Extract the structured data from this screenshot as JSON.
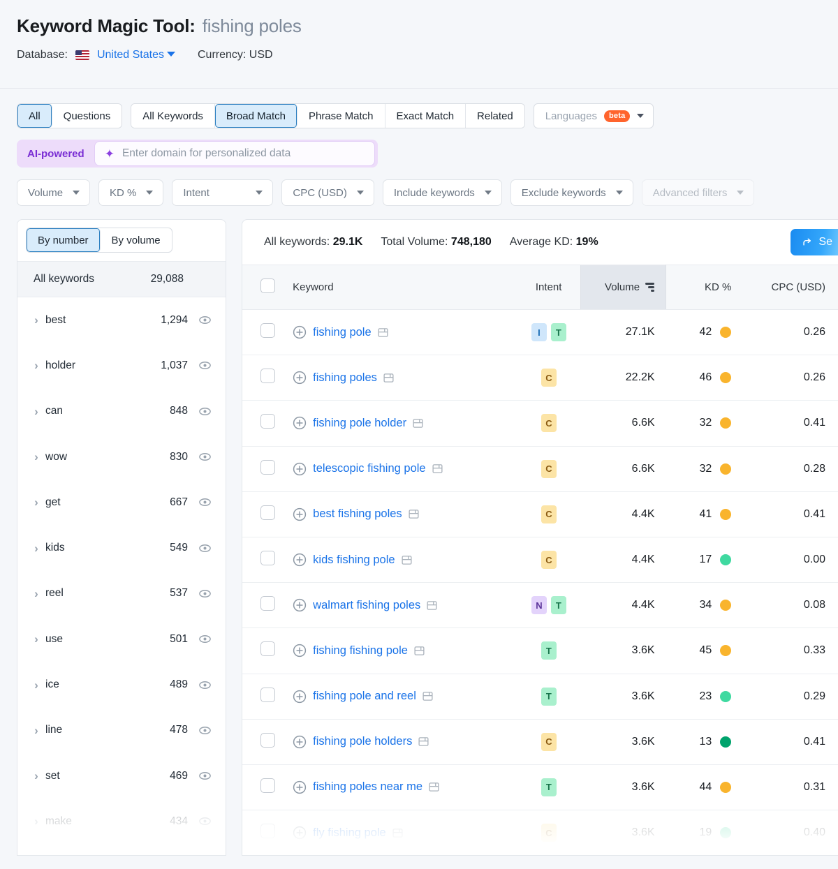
{
  "header": {
    "title_prefix": "Keyword Magic Tool:",
    "query": "fishing poles",
    "database_label": "Database:",
    "database_value": "United States",
    "currency": "Currency: USD",
    "flag_icon": "us-flag-icon"
  },
  "tabs": {
    "scope": [
      {
        "label": "All",
        "active": true
      },
      {
        "label": "Questions",
        "active": false
      }
    ],
    "match": [
      {
        "label": "All Keywords",
        "active": false
      },
      {
        "label": "Broad Match",
        "active": true
      },
      {
        "label": "Phrase Match",
        "active": false
      },
      {
        "label": "Exact Match",
        "active": false
      },
      {
        "label": "Related",
        "active": false
      }
    ],
    "languages": {
      "label": "Languages",
      "badge": "beta"
    }
  },
  "ai_bar": {
    "tag": "AI-powered",
    "placeholder": "Enter domain for personalized data",
    "spark_icon": "sparkle-icon"
  },
  "filters": [
    {
      "label": "Volume",
      "faded": false
    },
    {
      "label": "KD %",
      "faded": false
    },
    {
      "label": "Intent",
      "faded": false
    },
    {
      "label": "CPC (USD)",
      "faded": false
    },
    {
      "label": "Include keywords",
      "faded": false
    },
    {
      "label": "Exclude keywords",
      "faded": false
    },
    {
      "label": "Advanced filters",
      "faded": true
    }
  ],
  "sidebar": {
    "toggle": [
      {
        "label": "By number",
        "active": true
      },
      {
        "label": "By volume",
        "active": false
      }
    ],
    "all_keywords_label": "All keywords",
    "all_keywords_count": "29,088",
    "items": [
      {
        "label": "best",
        "count": "1,294",
        "dim": false
      },
      {
        "label": "holder",
        "count": "1,037",
        "dim": false
      },
      {
        "label": "can",
        "count": "848",
        "dim": false
      },
      {
        "label": "wow",
        "count": "830",
        "dim": false
      },
      {
        "label": "get",
        "count": "667",
        "dim": false
      },
      {
        "label": "kids",
        "count": "549",
        "dim": false
      },
      {
        "label": "reel",
        "count": "537",
        "dim": false
      },
      {
        "label": "use",
        "count": "501",
        "dim": false
      },
      {
        "label": "ice",
        "count": "489",
        "dim": false
      },
      {
        "label": "line",
        "count": "478",
        "dim": false
      },
      {
        "label": "set",
        "count": "469",
        "dim": false
      },
      {
        "label": "make",
        "count": "434",
        "dim": true
      }
    ]
  },
  "summary": {
    "all_keywords_label": "All keywords:",
    "all_keywords_value": "29.1K",
    "total_volume_label": "Total Volume:",
    "total_volume_value": "748,180",
    "average_kd_label": "Average KD:",
    "average_kd_value": "19%",
    "send_button_label": "Se"
  },
  "table": {
    "columns": {
      "keyword": "Keyword",
      "intent": "Intent",
      "volume": "Volume",
      "kd": "KD %",
      "cpc": "CPC (USD)"
    },
    "sorted_by": "volume",
    "rows": [
      {
        "keyword": "fishing pole",
        "intent": [
          "I",
          "T"
        ],
        "volume": "27.1K",
        "kd": "42",
        "kd_color": "#f9b42d",
        "cpc": "0.26",
        "faded": false
      },
      {
        "keyword": "fishing poles",
        "intent": [
          "C"
        ],
        "volume": "22.2K",
        "kd": "46",
        "kd_color": "#f9b42d",
        "cpc": "0.26",
        "faded": false
      },
      {
        "keyword": "fishing pole holder",
        "intent": [
          "C"
        ],
        "volume": "6.6K",
        "kd": "32",
        "kd_color": "#f9b42d",
        "cpc": "0.41",
        "faded": false
      },
      {
        "keyword": "telescopic fishing pole",
        "intent": [
          "C"
        ],
        "volume": "6.6K",
        "kd": "32",
        "kd_color": "#f9b42d",
        "cpc": "0.28",
        "faded": false
      },
      {
        "keyword": "best fishing poles",
        "intent": [
          "C"
        ],
        "volume": "4.4K",
        "kd": "41",
        "kd_color": "#f9b42d",
        "cpc": "0.41",
        "faded": false
      },
      {
        "keyword": "kids fishing pole",
        "intent": [
          "C"
        ],
        "volume": "4.4K",
        "kd": "17",
        "kd_color": "#3fd9a0",
        "cpc": "0.00",
        "faded": false
      },
      {
        "keyword": "walmart fishing poles",
        "intent": [
          "N",
          "T"
        ],
        "volume": "4.4K",
        "kd": "34",
        "kd_color": "#f9b42d",
        "cpc": "0.08",
        "faded": false
      },
      {
        "keyword": "fishing fishing pole",
        "intent": [
          "T"
        ],
        "volume": "3.6K",
        "kd": "45",
        "kd_color": "#f9b42d",
        "cpc": "0.33",
        "faded": false
      },
      {
        "keyword": "fishing pole and reel",
        "intent": [
          "T"
        ],
        "volume": "3.6K",
        "kd": "23",
        "kd_color": "#3fd9a0",
        "cpc": "0.29",
        "faded": false
      },
      {
        "keyword": "fishing pole holders",
        "intent": [
          "C"
        ],
        "volume": "3.6K",
        "kd": "13",
        "kd_color": "#00a36c",
        "cpc": "0.41",
        "faded": false
      },
      {
        "keyword": "fishing poles near me",
        "intent": [
          "T"
        ],
        "volume": "3.6K",
        "kd": "44",
        "kd_color": "#f9b42d",
        "cpc": "0.31",
        "faded": false
      },
      {
        "keyword": "fly fishing pole",
        "intent": [
          "C"
        ],
        "volume": "3.6K",
        "kd": "19",
        "kd_color": "#3fd9a0",
        "cpc": "0.40",
        "faded": true
      }
    ]
  },
  "colors": {
    "accent_blue": "#1a73e8",
    "active_tab_bg": "#d9ecfb",
    "active_tab_border": "#2b7fc1",
    "ai_purple": "#7b2fd4",
    "beta_orange": "#ff642d"
  }
}
